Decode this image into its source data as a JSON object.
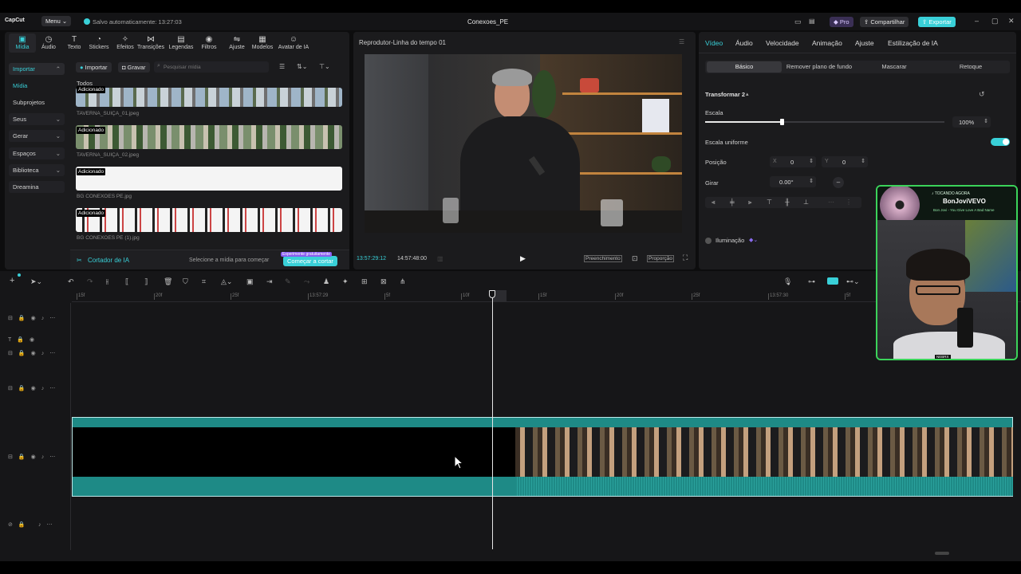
{
  "app": {
    "logo": "CapCut",
    "menu": "Menu",
    "autosave": "Salvo automaticamente: 13:27:03",
    "project_title": "Conexoes_PE",
    "pro": "Pro",
    "share": "Compartilhar",
    "export": "Exportar"
  },
  "tabs": [
    {
      "label": "Mídia",
      "icon": "media-icon"
    },
    {
      "label": "Áudio",
      "icon": "audio-icon"
    },
    {
      "label": "Texto",
      "icon": "text-icon"
    },
    {
      "label": "Stickers",
      "icon": "sticker-icon"
    },
    {
      "label": "Efeitos",
      "icon": "effects-icon"
    },
    {
      "label": "Transições",
      "icon": "transitions-icon"
    },
    {
      "label": "Legendas",
      "icon": "captions-icon"
    },
    {
      "label": "Filtros",
      "icon": "filters-icon"
    },
    {
      "label": "Ajuste",
      "icon": "adjust-icon"
    },
    {
      "label": "Modelos",
      "icon": "templates-icon"
    },
    {
      "label": "Avatar de IA",
      "icon": "avatar-icon"
    }
  ],
  "sidebar": {
    "items": [
      "Importar",
      "Mídia",
      "Subprojetos",
      "Seus",
      "Gerar",
      "Espaços",
      "Biblioteca",
      "Dreamina"
    ]
  },
  "media": {
    "import": "Importar",
    "record": "Gravar",
    "search_placeholder": "Pesquisar mídia",
    "all": "Todos",
    "items": [
      {
        "badge": "Adicionado",
        "name": "TAVERNA_SUIÇA_01.jpeg"
      },
      {
        "badge": "Adicionado",
        "name": "TAVERNA_SUIÇA_02.jpeg"
      },
      {
        "badge": "Adicionado",
        "name": "BG CONEXOES PE.jpg"
      },
      {
        "badge": "Adicionado",
        "name": "BG CONEXOES PE (1).jpg"
      }
    ],
    "cutter": "Cortador de IA",
    "cutter_hint": "Selecione a mídia para começar",
    "cutter_button": "Começar a cortar",
    "cutter_tag": "Experimente gratuitamente"
  },
  "player": {
    "title": "Reprodutor-Linha do tempo 01",
    "current_time": "13:57:29:12",
    "total_time": "14:57:48:00",
    "fill": "Preenchimento",
    "ratio": "Proporção"
  },
  "inspector": {
    "tabs": [
      "Vídeo",
      "Áudio",
      "Velocidade",
      "Animação",
      "Ajuste",
      "Estilização de IA"
    ],
    "subtabs": [
      "Básico",
      "Remover plano de fundo",
      "Mascarar",
      "Retoque"
    ],
    "section": "Transformar 2",
    "scale_label": "Escala",
    "scale_value": "100%",
    "scale_fraction": 0.32,
    "uniform_label": "Escala uniforme",
    "position_label": "Posição",
    "x_label": "X",
    "x_value": "0",
    "y_label": "Y",
    "y_value": "0",
    "rotate_label": "Girar",
    "rotate_value": "0.00°",
    "lighting": "Iluminação"
  },
  "timeline": {
    "ticks": [
      "15f",
      "20f",
      "25f",
      "13:57:29",
      "5f",
      "10f",
      "15f",
      "20f",
      "25f",
      "13:57:30",
      "5f"
    ]
  },
  "webcam": {
    "now_playing": "♪ TOCANDO AGORA",
    "artist": "BonJoviVEVO",
    "song": "Bon Jovi - You Give Love A Bad Name",
    "footer": "NEBRX"
  },
  "colors": {
    "accent": "#39d0d8",
    "clip": "#1e8a86",
    "bg": "#0d0d0e"
  }
}
